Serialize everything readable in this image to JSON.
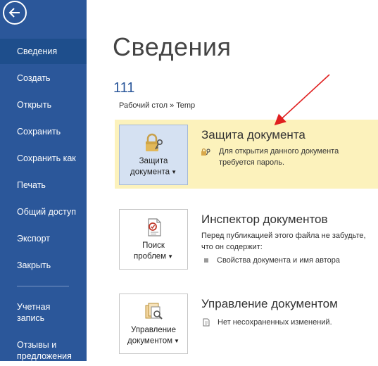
{
  "sidebar": {
    "items": [
      {
        "label": "Сведения",
        "active": true
      },
      {
        "label": "Создать"
      },
      {
        "label": "Открыть"
      },
      {
        "label": "Сохранить"
      },
      {
        "label": "Сохранить как"
      },
      {
        "label": "Печать"
      },
      {
        "label": "Общий доступ"
      },
      {
        "label": "Экспорт"
      },
      {
        "label": "Закрыть"
      }
    ],
    "bottom_items": [
      {
        "line1": "Учетная",
        "line2": "запись"
      },
      {
        "line1": "Отзывы и",
        "line2": "предложения"
      }
    ],
    "back_icon": "back-arrow-icon"
  },
  "main": {
    "title": "Сведения",
    "doc_name": "111",
    "doc_path": "Рабочий стол » Temp",
    "protect": {
      "button_line1": "Защита",
      "button_line2": "документа",
      "title": "Защита документа",
      "desc_line1": "Для открытия данного документа",
      "desc_line2": "требуется пароль.",
      "icon": "lock-key-icon",
      "highlight_color": "#fcf2bc"
    },
    "inspect": {
      "button_line1": "Поиск",
      "button_line2": "проблем",
      "title": "Инспектор документов",
      "desc_line1": "Перед публикацией этого файла не забудьте,",
      "desc_line2": "что он содержит:",
      "bullet": "Свойства документа и имя автора",
      "icon": "inspect-document-icon"
    },
    "manage": {
      "button_line1": "Управление",
      "button_line2": "документом",
      "title": "Управление документом",
      "bullet": "Нет несохраненных изменений.",
      "icon": "manage-document-icon"
    }
  },
  "colors": {
    "sidebar_bg": "#2b579a",
    "sidebar_active": "#1e4e8c",
    "accent": "#2b579a",
    "annotation_arrow": "#e02020"
  }
}
